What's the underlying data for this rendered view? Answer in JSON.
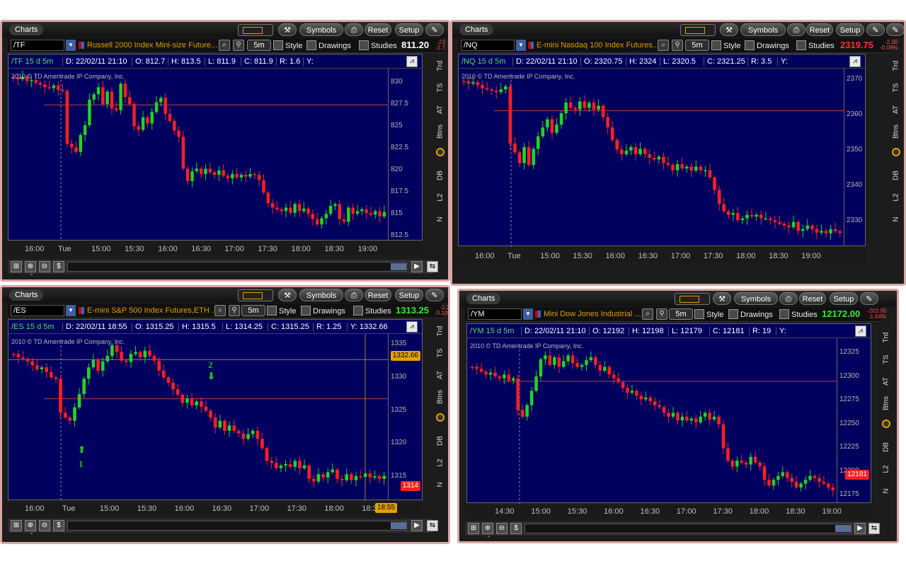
{
  "windows": [
    {
      "id": "tf",
      "title": "Charts",
      "toolbar": {
        "symbols": "Symbols",
        "reset": "Reset",
        "setup": "Setup"
      },
      "symbol": "/TF",
      "name": "Russell 2000 Index Mini-size Future...",
      "aggregation": "5m",
      "tools": {
        "style": "Style",
        "drawings": "Drawings",
        "studies": "Studies"
      },
      "last": "811.20",
      "change": [
        "-23",
        "-2.7"
      ],
      "change_color": "#ff4b4b",
      "last_color": "#ffffff",
      "info": {
        "sym": "/TF 15 d 5m",
        "d": "D: 22/02/11 21:10",
        "o": "O: 812.7",
        "h": "H: 813.5",
        "l": "L: 811.9",
        "c": "C: 811.9",
        "r": "R: 1.6",
        "y": "Y:"
      },
      "copyright": "2010 © TD Ameritrade IP Company, Inc.",
      "y_ticks": [
        "830",
        "827.5",
        "825",
        "822.5",
        "820",
        "817.5",
        "815",
        "812.5"
      ],
      "x_ticks": [
        "16:00",
        "Tue",
        "15:00",
        "15:30",
        "16:00",
        "16:30",
        "17:00",
        "17:30",
        "18:00",
        "18:30",
        "19:00"
      ],
      "ylim": [
        812,
        831.5
      ],
      "hline": 827.4,
      "candles": [
        830.5,
        830.3,
        830.6,
        830.1,
        830.2,
        829.9,
        829.7,
        829.4,
        829.3,
        829.6,
        829.1,
        829.0,
        823.0,
        822.6,
        822.1,
        824.0,
        825.1,
        828.0,
        828.6,
        829.4,
        827.5,
        828.9,
        827.0,
        826.8,
        829.8,
        828.3,
        827.5,
        825.0,
        824.6,
        826.0,
        825.3,
        826.6,
        827.7,
        828.2,
        826.4,
        825.6,
        824.5,
        823.8,
        820.2,
        818.8,
        819.9,
        820.2,
        819.6,
        820.2,
        819.8,
        819.5,
        820.0,
        819.4,
        819.1,
        819.6,
        819.2,
        819.5,
        819.3,
        819.6,
        819.5,
        818.9,
        817.5,
        816.3,
        815.8,
        815.6,
        815.4,
        815.8,
        815.2,
        816.2,
        815.4,
        815.7,
        815.1,
        814.5,
        813.9,
        814.6,
        815.1,
        816.0,
        816.2,
        814.5,
        814.2,
        815.8,
        815.1,
        815.4,
        815.6,
        815.2,
        815.0,
        815.4,
        814.8,
        815.3
      ]
    },
    {
      "id": "nq",
      "title": "Charts",
      "toolbar": {
        "symbols": "Symbols",
        "reset": "Reset",
        "setup": "Setup"
      },
      "symbol": "/NQ",
      "name": "E-mini Nasdaq 100 Index Futures...",
      "aggregation": "5m",
      "tools": {
        "style": "Style",
        "drawings": "Drawings",
        "studies": "Studies"
      },
      "last": "2319.75",
      "change": [
        "-2.00",
        "-0.09%"
      ],
      "change_color": "#ff4b4b",
      "last_color": "#ff3030",
      "info": {
        "sym": "/NQ 15 d 5m",
        "d": "D: 22/02/11 21:10",
        "o": "O: 2320.75",
        "h": "H: 2324",
        "l": "L: 2320.5",
        "c": "C: 2321.25",
        "r": "R: 3.5",
        "y": "Y:"
      },
      "copyright": "2010 © TD Ameritrade IP Company, Inc.",
      "y_ticks": [
        "2370",
        "2360",
        "2350",
        "2340",
        "2330"
      ],
      "x_ticks": [
        "16:00",
        "Tue",
        "15:00",
        "15:30",
        "16:00",
        "16:30",
        "17:00",
        "17:30",
        "18:00",
        "18:30",
        "19:00"
      ],
      "ylim": [
        2323,
        2373
      ],
      "hline": 2361.2,
      "candles": [
        2369.5,
        2368.8,
        2369.2,
        2368.4,
        2367.5,
        2367.2,
        2366.8,
        2366.4,
        2367.2,
        2368.0,
        2352.0,
        2349.5,
        2346.5,
        2351.0,
        2346.0,
        2350.5,
        2354.0,
        2356.5,
        2358.8,
        2355.0,
        2357.3,
        2360.5,
        2363.5,
        2362.0,
        2361.5,
        2363.8,
        2362.0,
        2363.4,
        2361.5,
        2362.6,
        2359.4,
        2356.5,
        2353.0,
        2350.3,
        2349.0,
        2350.0,
        2351.0,
        2349.0,
        2350.5,
        2349.0,
        2348.0,
        2347.5,
        2348.3,
        2346.5,
        2346.0,
        2344.5,
        2346.2,
        2345.0,
        2345.5,
        2344.4,
        2345.5,
        2344.5,
        2344.5,
        2342.5,
        2339.0,
        2335.0,
        2333.0,
        2332.0,
        2332.5,
        2330.5,
        2331.0,
        2332.0,
        2331.5,
        2332.0,
        2331.0,
        2331.0,
        2330.5,
        2330.0,
        2329.5,
        2329.0,
        2328.5,
        2330.0,
        2327.5,
        2328.0,
        2329.0,
        2328.0,
        2327.0,
        2327.5,
        2326.8,
        2328.0,
        2327.4,
        2326.9
      ]
    },
    {
      "id": "es",
      "title": "Charts",
      "toolbar": {
        "symbols": "Symbols",
        "reset": "Reset",
        "setup": "Setup"
      },
      "symbol": "/ES",
      "name": "E-mini S&P 500 Index Futures,ETH ...",
      "aggregation": "5m",
      "tools": {
        "style": "Style",
        "drawings": "Drawings",
        "studies": "Studies"
      },
      "last": "1313.25",
      "change": [
        "-1.25",
        "-0.10%"
      ],
      "change_color": "#ff4b4b",
      "last_color": "#37e637",
      "info": {
        "sym": "/ES 15 d 5m",
        "d": "D: 22/02/11 18:55",
        "o": "O: 1315.25",
        "h": "H: 1315.5",
        "l": "L: 1314.25",
        "c": "C: 1315.25",
        "r": "R: 1.25",
        "y": "Y: 1332.66"
      },
      "copyright": "2010 © TD Ameritrade IP Company, Inc.",
      "y_ticks": [
        "1335",
        "1330",
        "1325",
        "1320",
        "1315"
      ],
      "x_ticks": [
        "16:00",
        "Tue",
        "15:00",
        "15:30",
        "16:00",
        "16:30",
        "17:00",
        "17:30",
        "18:00",
        "18:30"
      ],
      "crosshair_y": "1332.66",
      "crosshair_x": "18:55",
      "price_tag": "1314",
      "marker_labels": [
        "1",
        "2"
      ],
      "ylim": [
        1311.5,
        1336.5
      ],
      "hline": 1326.8,
      "candles": [
        1333.5,
        1333.0,
        1332.8,
        1332.4,
        1331.8,
        1331.2,
        1331.5,
        1330.8,
        1330.0,
        1329.8,
        1324.7,
        1324.0,
        1323.5,
        1325.5,
        1327.5,
        1329.8,
        1331.5,
        1332.6,
        1331.0,
        1332.4,
        1333.2,
        1334.8,
        1333.8,
        1332.5,
        1332.3,
        1333.5,
        1333.8,
        1333.0,
        1334.0,
        1333.2,
        1332.5,
        1331.0,
        1330.0,
        1329.2,
        1328.2,
        1327.4,
        1326.2,
        1326.8,
        1325.8,
        1326.4,
        1325.6,
        1325.0,
        1324.0,
        1322.5,
        1323.5,
        1322.0,
        1322.8,
        1322.0,
        1321.6,
        1320.8,
        1321.5,
        1322.0,
        1320.8,
        1319.4,
        1317.5,
        1317.2,
        1316.4,
        1316.8,
        1317.0,
        1316.6,
        1317.5,
        1316.4,
        1316.8,
        1314.8,
        1314.4,
        1315.5,
        1315.0,
        1315.8,
        1316.2,
        1314.8,
        1314.6,
        1315.5,
        1314.6,
        1315.2,
        1315.1,
        1315.6,
        1315.0,
        1315.2,
        1314.8,
        1315.25
      ]
    },
    {
      "id": "ym",
      "title": "Charts",
      "toolbar": {
        "symbols": "Symbols",
        "reset": "Reset",
        "setup": "Setup"
      },
      "symbol": "/YM",
      "name": "Mini Dow Jones Industrial ...",
      "aggregation": "5m",
      "tools": {
        "style": "Style",
        "drawings": "Drawings",
        "studies": "Studies"
      },
      "last": "12172.00",
      "change": [
        "-203.00",
        "-1.64%"
      ],
      "change_color": "#ff4b4b",
      "last_color": "#37e637",
      "info": {
        "sym": "/YM 15 d 5m",
        "d": "D: 22/02/11 21:10",
        "o": "O: 12192",
        "h": "H: 12198",
        "l": "L: 12179",
        "c": "C: 12181",
        "r": "R: 19",
        "y": "Y:"
      },
      "copyright": "2010 © TD Ameritrade IP Company, Inc.",
      "y_ticks": [
        "12325",
        "12300",
        "12275",
        "12250",
        "12225",
        "12200",
        "12175"
      ],
      "x_ticks": [
        "14:30",
        "15:00",
        "15:30",
        "16:00",
        "16:30",
        "17:00",
        "17:30",
        "18:00",
        "18:30",
        "19:00"
      ],
      "price_tag": "12181",
      "ylim": [
        12167,
        12340
      ],
      "hline": 12295,
      "candles": [
        12310,
        12308,
        12305,
        12302,
        12304,
        12300,
        12298,
        12302,
        12296,
        12298,
        12265,
        12258,
        12270,
        12285,
        12300,
        12318,
        12322,
        12312,
        12320,
        12310,
        12316,
        12322,
        12314,
        12310,
        12312,
        12317,
        12320,
        12312,
        12306,
        12310,
        12302,
        12298,
        12294,
        12288,
        12283,
        12285,
        12280,
        12276,
        12278,
        12274,
        12270,
        12268,
        12262,
        12258,
        12262,
        12254,
        12258,
        12254,
        12256,
        12252,
        12258,
        12262,
        12255,
        12258,
        12250,
        12225,
        12212,
        12206,
        12212,
        12210,
        12208,
        12216,
        12210,
        12206,
        12192,
        12186,
        12192,
        12196,
        12200,
        12194,
        12190,
        12184,
        12188,
        12192,
        12196,
        12194,
        12190,
        12188,
        12184,
        12181
      ]
    }
  ],
  "sidebar": [
    "Trd",
    "TS",
    "AT",
    "Btns",
    "C",
    "DB",
    "L2",
    "N"
  ],
  "icons": {
    "wrench": "wrench-icon",
    "print": "print-icon",
    "pin": "pin-icon",
    "grid": "grid-icon"
  },
  "colors": {
    "up": "#22d422",
    "down": "#ff1e1e",
    "hline": "#c04040",
    "bg": "#00005e"
  }
}
